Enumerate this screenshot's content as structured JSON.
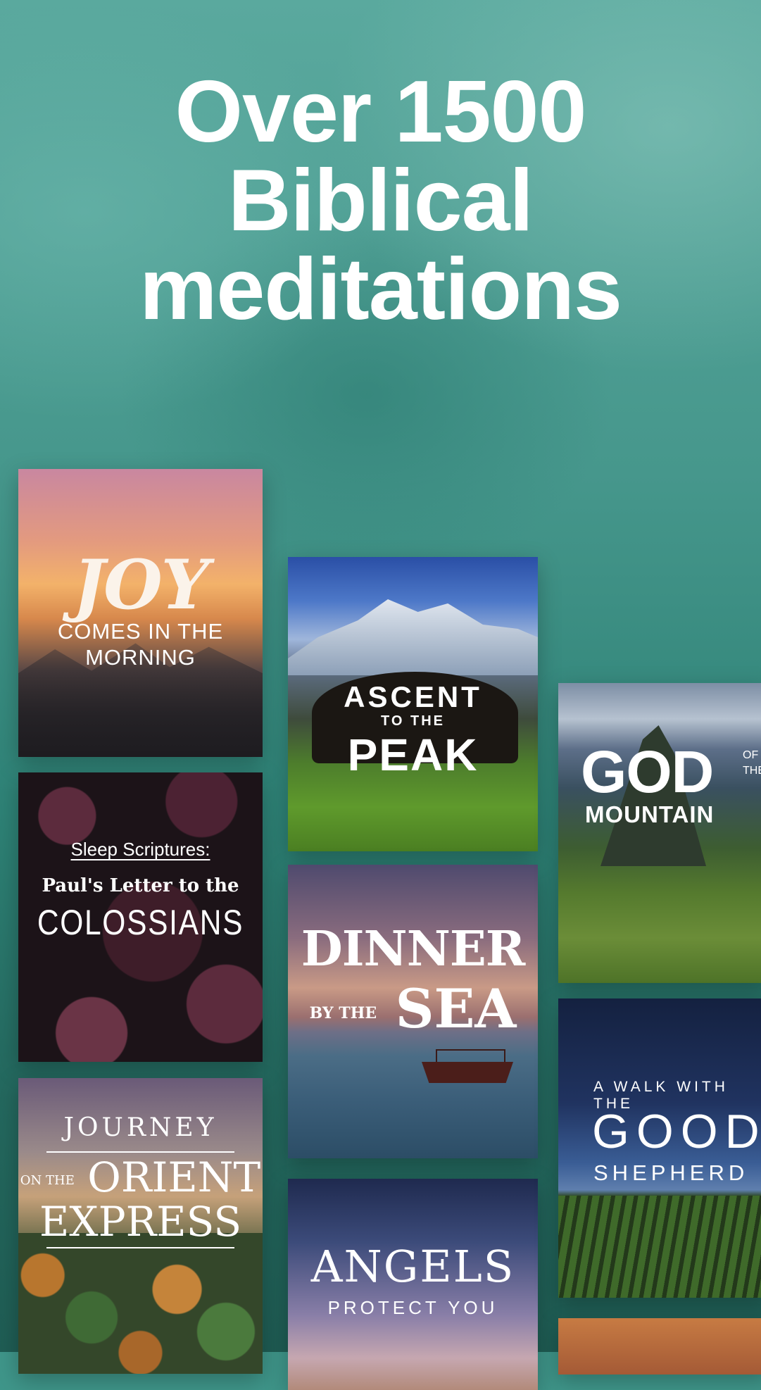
{
  "headline": {
    "line1": "Over 1500",
    "line2": "Biblical",
    "line3": "meditations"
  },
  "cards": {
    "joy": {
      "title": "JOY",
      "subtitle_line1": "COMES IN THE",
      "subtitle_line2": "MORNING"
    },
    "colossians": {
      "line1": "Sleep Scriptures:",
      "line2": "Paul's Letter to the",
      "line3": "COLOSSIANS"
    },
    "orient": {
      "line1": "JOURNEY",
      "on_the": "ON THE",
      "line2": "ORIENT",
      "line3": "EXPRESS"
    },
    "ascent": {
      "line1": "ASCENT",
      "line2": "TO THE",
      "line3": "PEAK"
    },
    "dinner": {
      "line1": "DINNER",
      "by_the": "BY THE",
      "line2": "SEA"
    },
    "angels": {
      "line1": "ANGELS",
      "line2": "PROTECT YOU"
    },
    "god": {
      "line1": "GOD",
      "of_the": "OF THE",
      "line2": "MOUNTAIN"
    },
    "shepherd": {
      "line1": "A WALK WITH THE",
      "line2": "GOOD",
      "line3": "SHEPHERD"
    }
  }
}
